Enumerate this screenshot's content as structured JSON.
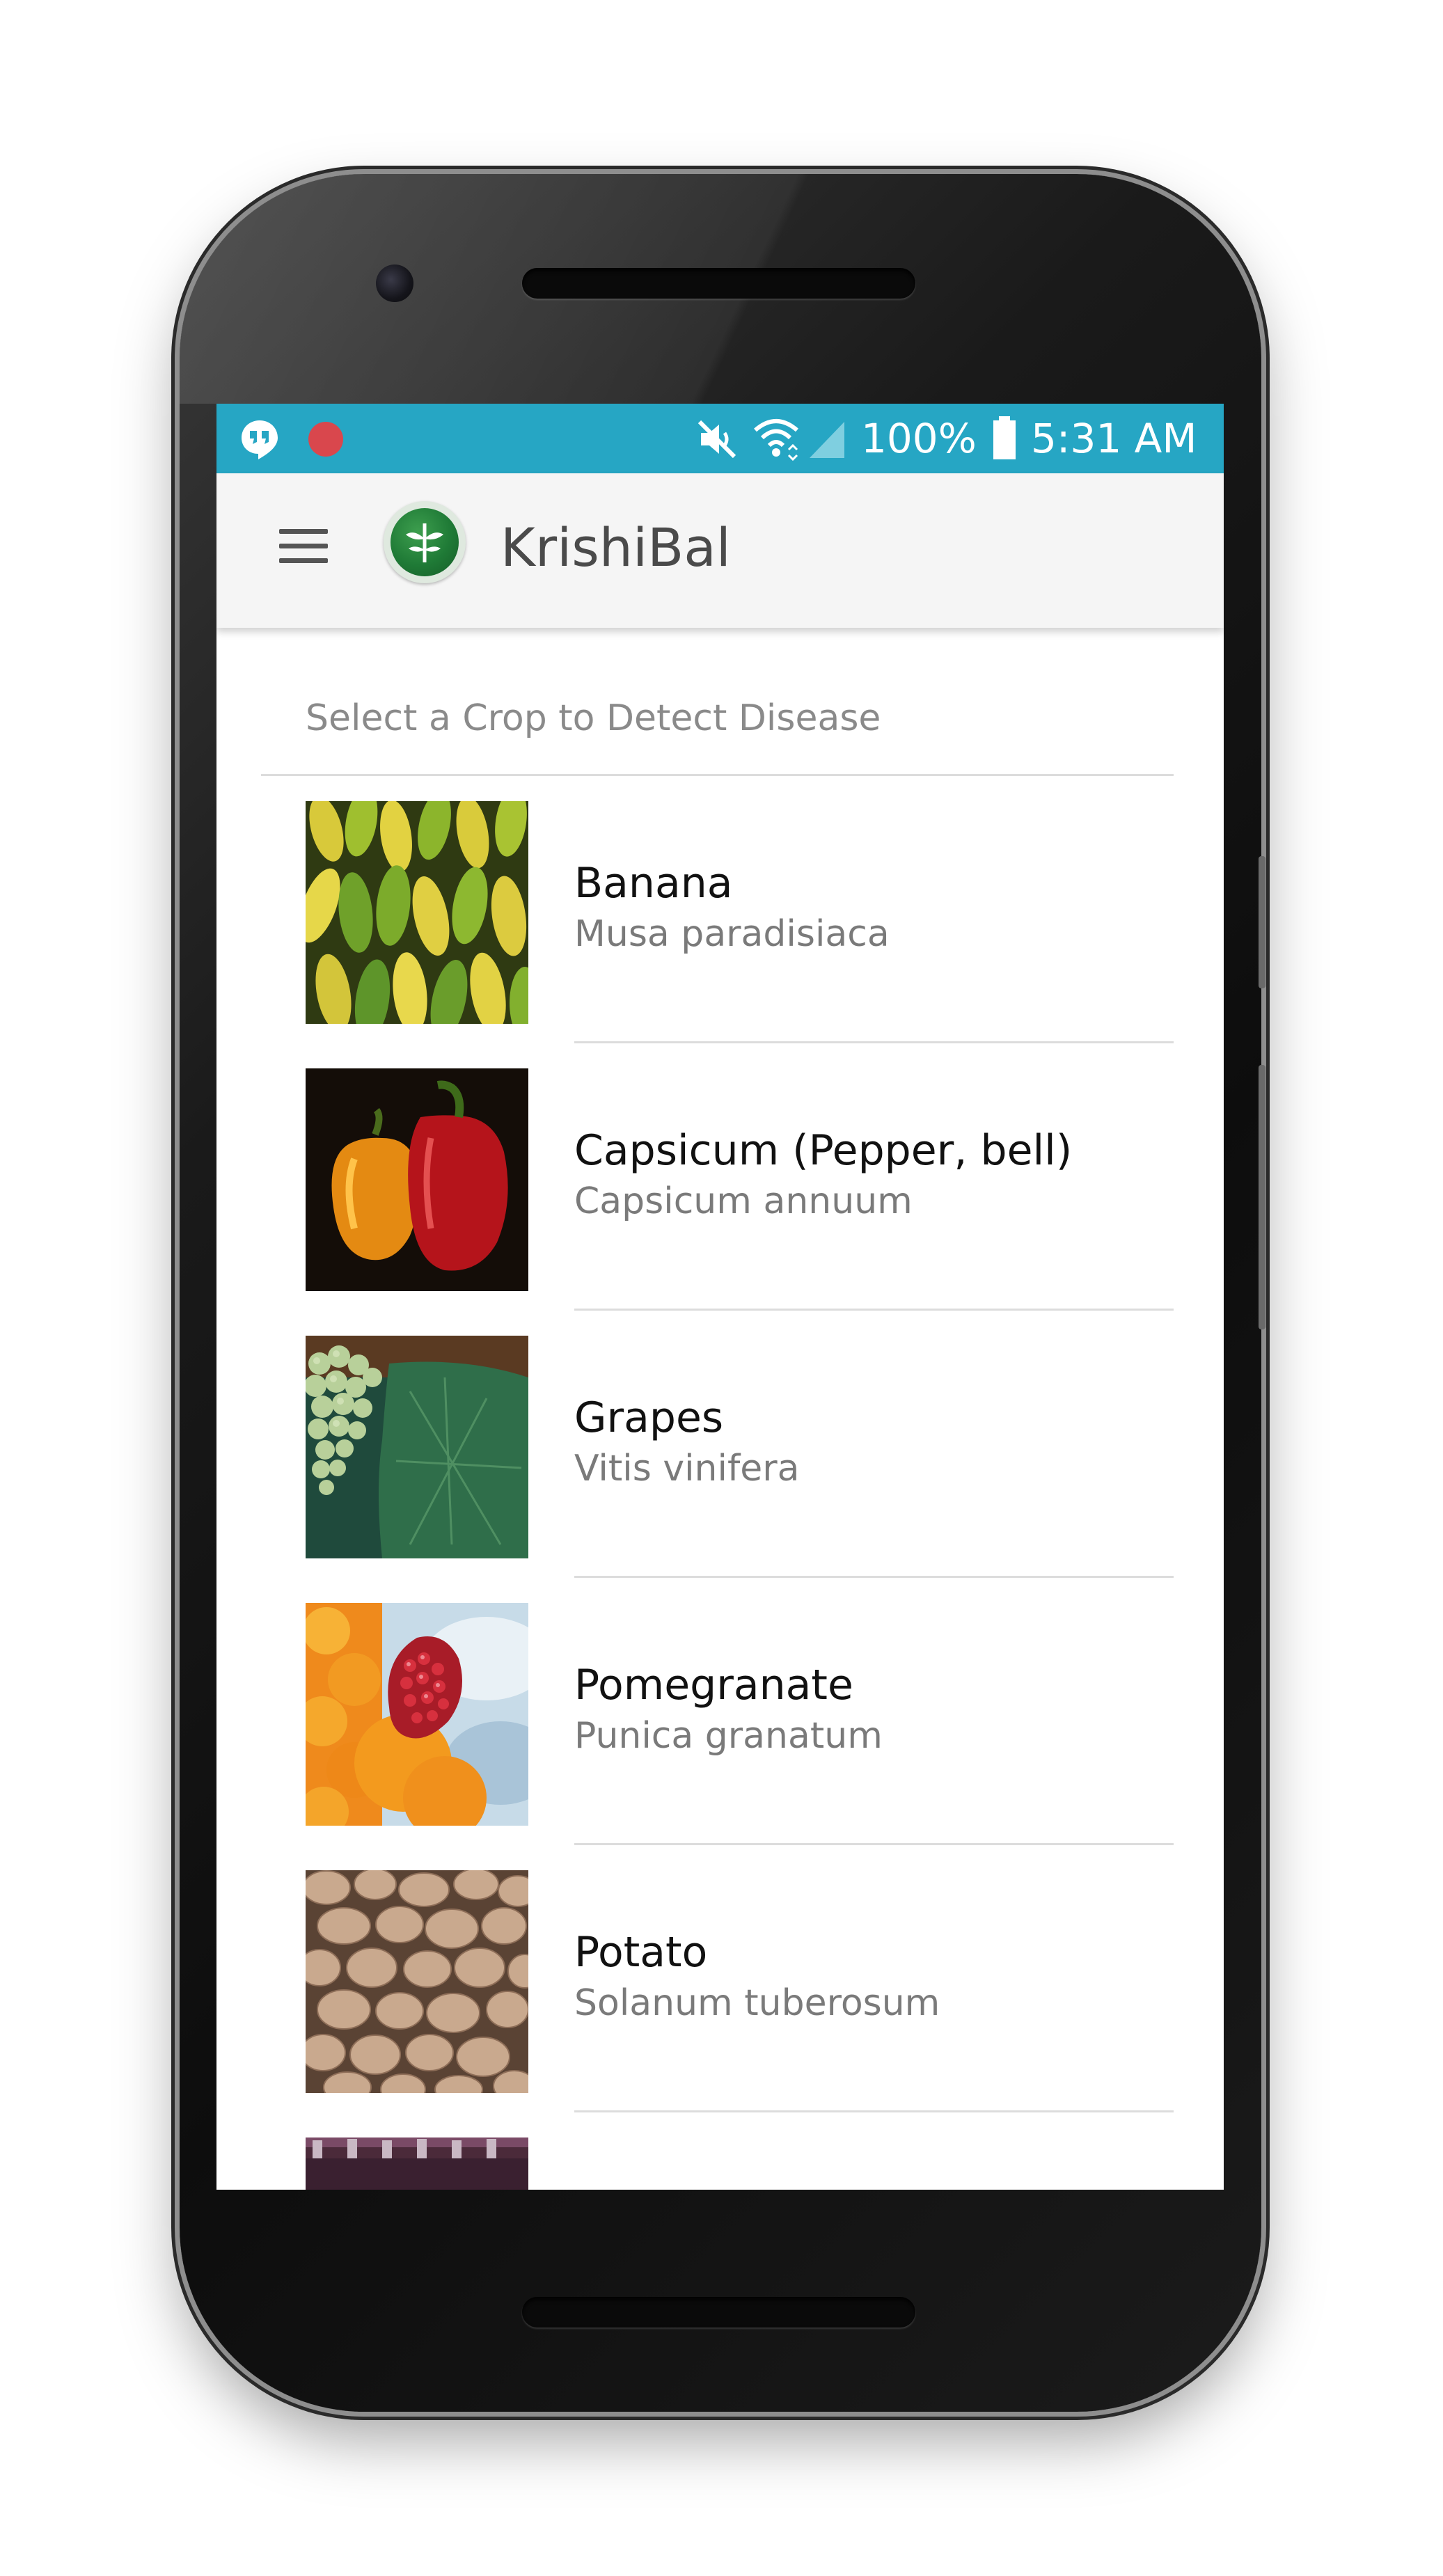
{
  "status_bar": {
    "battery_percent": "100%",
    "time": "5:31 AM",
    "icons": [
      "hangouts-icon",
      "record-icon",
      "mute-icon",
      "wifi-icon",
      "signal-icon",
      "battery-icon"
    ],
    "background_color": "#26a6c4"
  },
  "app_bar": {
    "title": "KrishiBal",
    "menu_icon": "hamburger-menu-icon",
    "logo_icon": "plant-logo-icon",
    "background_color": "#f5f5f5"
  },
  "crop_list": {
    "header": "Select a Crop to Detect Disease",
    "items": [
      {
        "name": "Banana",
        "scientific_name": "Musa paradisiaca",
        "image": "banana-image"
      },
      {
        "name": "Capsicum (Pepper, bell)",
        "scientific_name": "Capsicum annuum",
        "image": "bell-pepper-image"
      },
      {
        "name": "Grapes",
        "scientific_name": "Vitis vinifera",
        "image": "grapes-image"
      },
      {
        "name": "Pomegranate",
        "scientific_name": "Punica granatum",
        "image": "pomegranate-image"
      },
      {
        "name": "Potato",
        "scientific_name": "Solanum tuberosum",
        "image": "potato-image"
      }
    ]
  }
}
